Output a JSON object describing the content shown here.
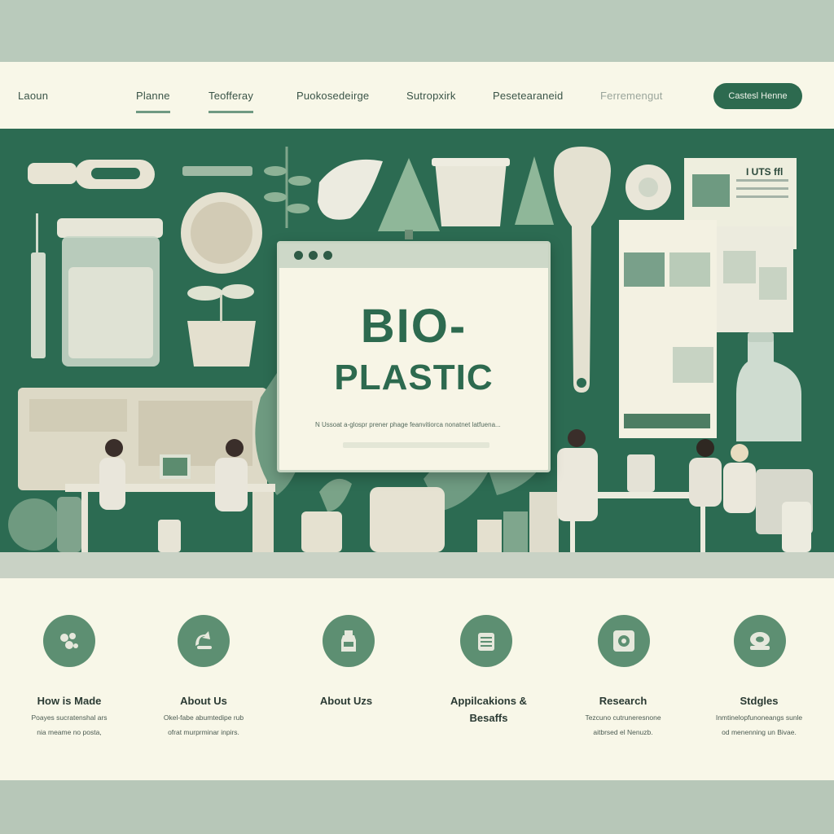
{
  "nav": {
    "logo": "Laoun",
    "items": [
      "Planne",
      "Teofferay",
      "Puokosedeirge",
      "Sutropxirk",
      "Pesetearaneid"
    ],
    "muted_item": "Ferremengut",
    "cta": "Castesl Henne"
  },
  "hero": {
    "title_line1": "BIO-",
    "title_line2": "PLASTIC",
    "description": "N Ussoat a-glospr prener  phage feanvitiorca nonatnet latfuena...",
    "doc_label": "I UTS ffl"
  },
  "features": [
    {
      "title": "How is Made",
      "desc": [
        "Poayes sucratenshal ars",
        "nia meame no posta,"
      ],
      "icon": "pellets-icon"
    },
    {
      "title": "About Us",
      "desc": [
        "Okel-fabe abumtedipe rub",
        "ofrat murprminar inpirs."
      ],
      "icon": "recycle-icon"
    },
    {
      "title": "About Uzs",
      "desc": [],
      "icon": "bottle-icon"
    },
    {
      "title": "Appilcakions &",
      "title2": "Besaffs",
      "desc": [],
      "icon": "container-icon"
    },
    {
      "title": "Research",
      "desc": [
        "Tezcuno cutruneresnone",
        "aitbrsed el Nenuzb."
      ],
      "icon": "research-icon"
    },
    {
      "title": "Stdgles",
      "desc": [
        "Inmtinelopfunoneangs sunle",
        "od menenning un Bivae."
      ],
      "icon": "roll-icon"
    }
  ],
  "colors": {
    "brand_green": "#2d6a4f",
    "hero_green": "#2c6b52",
    "circle_green": "#5d8f72",
    "cream": "#f8f7e8"
  }
}
